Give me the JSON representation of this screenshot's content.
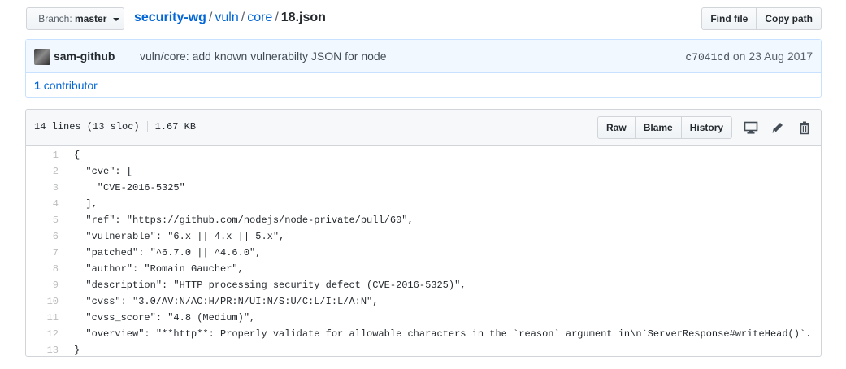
{
  "branch": {
    "prefix": "Branch:",
    "name": "master"
  },
  "breadcrumb": {
    "repo": "security-wg",
    "sep": "/",
    "parts": [
      "vuln",
      "core"
    ],
    "file": "18.json"
  },
  "header_actions": {
    "find_file": "Find file",
    "copy_path": "Copy path"
  },
  "commit": {
    "author": "sam-github",
    "message": "vuln/core: add known vulnerabilty JSON for node",
    "sha": "c7041cd",
    "date_text": "on 23 Aug 2017"
  },
  "contributors": {
    "count": "1",
    "label": "contributor"
  },
  "file": {
    "lines_info": "14 lines (13 sloc)",
    "size": "1.67 KB",
    "actions": {
      "raw": "Raw",
      "blame": "Blame",
      "history": "History"
    },
    "icons": [
      "desktop-icon",
      "pencil-icon",
      "trash-icon"
    ]
  },
  "code_lines": [
    {
      "n": "1",
      "text": "{"
    },
    {
      "n": "2",
      "text": "  \"cve\": ["
    },
    {
      "n": "3",
      "text": "    \"CVE-2016-5325\""
    },
    {
      "n": "4",
      "text": "  ],"
    },
    {
      "n": "5",
      "text": "  \"ref\": \"https://github.com/nodejs/node-private/pull/60\","
    },
    {
      "n": "6",
      "text": "  \"vulnerable\": \"6.x || 4.x || 5.x\","
    },
    {
      "n": "7",
      "text": "  \"patched\": \"^6.7.0 || ^4.6.0\","
    },
    {
      "n": "8",
      "text": "  \"author\": \"Romain Gaucher\","
    },
    {
      "n": "9",
      "text": "  \"description\": \"HTTP processing security defect (CVE-2016-5325)\","
    },
    {
      "n": "10",
      "text": "  \"cvss\": \"3.0/AV:N/AC:H/PR:N/UI:N/S:U/C:L/I:L/A:N\","
    },
    {
      "n": "11",
      "text": "  \"cvss_score\": \"4.8 (Medium)\","
    },
    {
      "n": "12",
      "text": "  \"overview\": \"**http**: Properly validate for allowable characters in the `reason` argument in\\n`ServerResponse#writeHead()`."
    },
    {
      "n": "13",
      "text": "}"
    }
  ]
}
